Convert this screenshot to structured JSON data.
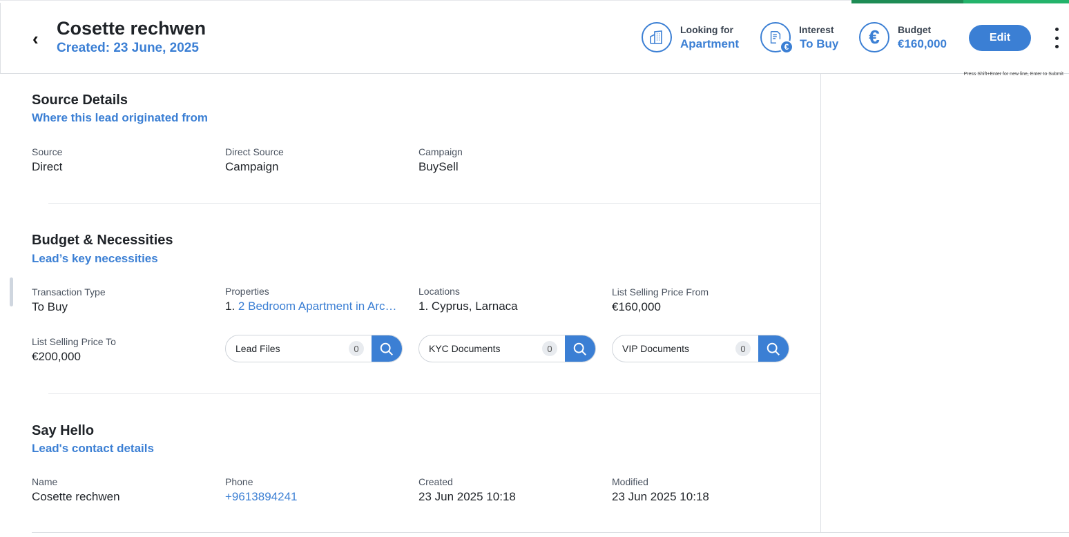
{
  "header": {
    "back_icon": "chevron-left-icon",
    "name": "Cosette rechwen",
    "created": "Created: 23 June, 2025",
    "stats": [
      {
        "label": "Looking for",
        "value": "Apartment",
        "icon": "building-icon"
      },
      {
        "label": "Interest",
        "value": "To Buy",
        "icon": "document-euro-icon"
      },
      {
        "label": "Budget",
        "value": "€160,000",
        "icon": "euro-icon"
      }
    ],
    "edit_label": "Edit",
    "hint": "Press Shift+Enter for new line, Enter to Submit"
  },
  "source": {
    "title": "Source Details",
    "subtitle": "Where this lead originated from",
    "fields": [
      {
        "label": "Source",
        "value": "Direct"
      },
      {
        "label": "Direct Source",
        "value": "Campaign"
      },
      {
        "label": "Campaign",
        "value": "BuySell"
      }
    ]
  },
  "budget": {
    "title": "Budget & Necessities",
    "subtitle": "Lead’s key necessities",
    "transaction": {
      "label": "Transaction Type",
      "value": "To Buy"
    },
    "properties": {
      "label": "Properties",
      "num": "1.",
      "value": "2 Bedroom Apartment in Arc…"
    },
    "locations": {
      "label": "Locations",
      "value": "1. Cyprus, Larnaca"
    },
    "price_from": {
      "label": "List Selling Price From",
      "value": "€160,000"
    },
    "price_to": {
      "label": "List Selling Price To",
      "value": "€200,000"
    },
    "docs": [
      {
        "label": "Lead Files",
        "count": "0"
      },
      {
        "label": "KYC Documents",
        "count": "0"
      },
      {
        "label": "VIP Documents",
        "count": "0"
      }
    ]
  },
  "contact": {
    "title": "Say Hello",
    "subtitle": "Lead's contact details",
    "fields": [
      {
        "label": "Name",
        "value": "Cosette rechwen"
      },
      {
        "label": "Phone",
        "value": "+9613894241"
      },
      {
        "label": "Created",
        "value": "23 Jun 2025 10:18"
      },
      {
        "label": "Modified",
        "value": "23 Jun 2025 10:18"
      }
    ]
  },
  "colors": {
    "accent": "#3b7fd4",
    "progress": "#24b36b"
  }
}
